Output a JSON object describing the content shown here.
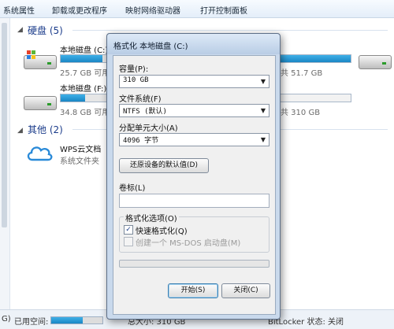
{
  "toolbar": {
    "items": [
      "系统属性",
      "卸载或更改程序",
      "映射网络驱动器",
      "打开控制面板"
    ]
  },
  "explorer": {
    "hard_disks_section": "硬盘 (5)",
    "other_section": "其他 (2)",
    "drives": [
      {
        "name": "本地磁盘 (C:)",
        "free_text": "25.7 GB 可用",
        "usage": 0.85
      },
      {
        "name": "本地磁盘 (F:)",
        "free_text": "34.8 GB 可用",
        "usage": 0.5
      }
    ],
    "right_drive_texts": [
      "共 51.7 GB",
      "共 310 GB"
    ],
    "wps": {
      "name": "WPS云文档",
      "type": "系统文件夹"
    }
  },
  "statusbar": {
    "left_fragment": "G)",
    "used_label": "已用空间:",
    "used_fraction": 0.62,
    "total_label": "总大小: 310 GB",
    "bitlocker_label": "BitLocker 状态: 关闭"
  },
  "dialog": {
    "title": "格式化 本地磁盘 (C:)",
    "capacity_label": "容量(P):",
    "capacity_value": "310 GB",
    "filesystem_label": "文件系统(F)",
    "filesystem_value": "NTFS (默认)",
    "alloc_label": "分配单元大小(A)",
    "alloc_value": "4096 字节",
    "restore_button": "还原设备的默认值(D)",
    "volume_label": "卷标(L)",
    "volume_value": "",
    "options_legend": "格式化选项(O)",
    "quick_format_label": "快速格式化(Q)",
    "quick_format_checked": true,
    "msdos_label": "创建一个 MS-DOS 启动盘(M)",
    "msdos_checked": false,
    "progress": 0,
    "start_button": "开始(S)",
    "close_button": "关闭(C)"
  }
}
